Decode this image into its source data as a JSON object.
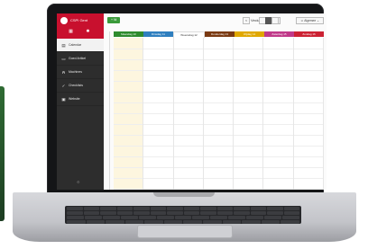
{
  "app": {
    "brand": "CSPI Gent",
    "footer_icon": "settings-icon"
  },
  "sidebar": {
    "items": [
      {
        "label": "Calendar",
        "icon": "calendar-icon",
        "active": true
      },
      {
        "label": "Goed Artikel",
        "icon": "card-icon",
        "active": false
      },
      {
        "label": "Machines",
        "icon": "bell-icon",
        "active": false
      },
      {
        "label": "Checklists",
        "icon": "check-icon",
        "active": false
      },
      {
        "label": "Website",
        "icon": "window-icon",
        "active": false
      }
    ]
  },
  "toolbar": {
    "new_label": "Ni",
    "prev_label": "<",
    "next_label": ">",
    "week_label": "Vecka 37",
    "user_label": "Algemee"
  },
  "days": [
    {
      "label": "Maandag 10",
      "color": "#2e8b2e"
    },
    {
      "label": "Dinsdag 11",
      "color": "#2f7fbf"
    },
    {
      "label": "Woensdag 12",
      "color": "#ffffff"
    },
    {
      "label": "Donderdag 13",
      "color": "#7a3a12"
    },
    {
      "label": "Vrijdag 14",
      "color": "#e0a800"
    },
    {
      "label": "Zaterdag 15",
      "color": "#c03a8a"
    },
    {
      "label": "Zondag 16",
      "color": "#cc2233"
    }
  ],
  "colors": {
    "sidebar_header": "#c8102e",
    "sidebar_bg": "#2d2d2d",
    "today_bg": "#fdf6df"
  }
}
